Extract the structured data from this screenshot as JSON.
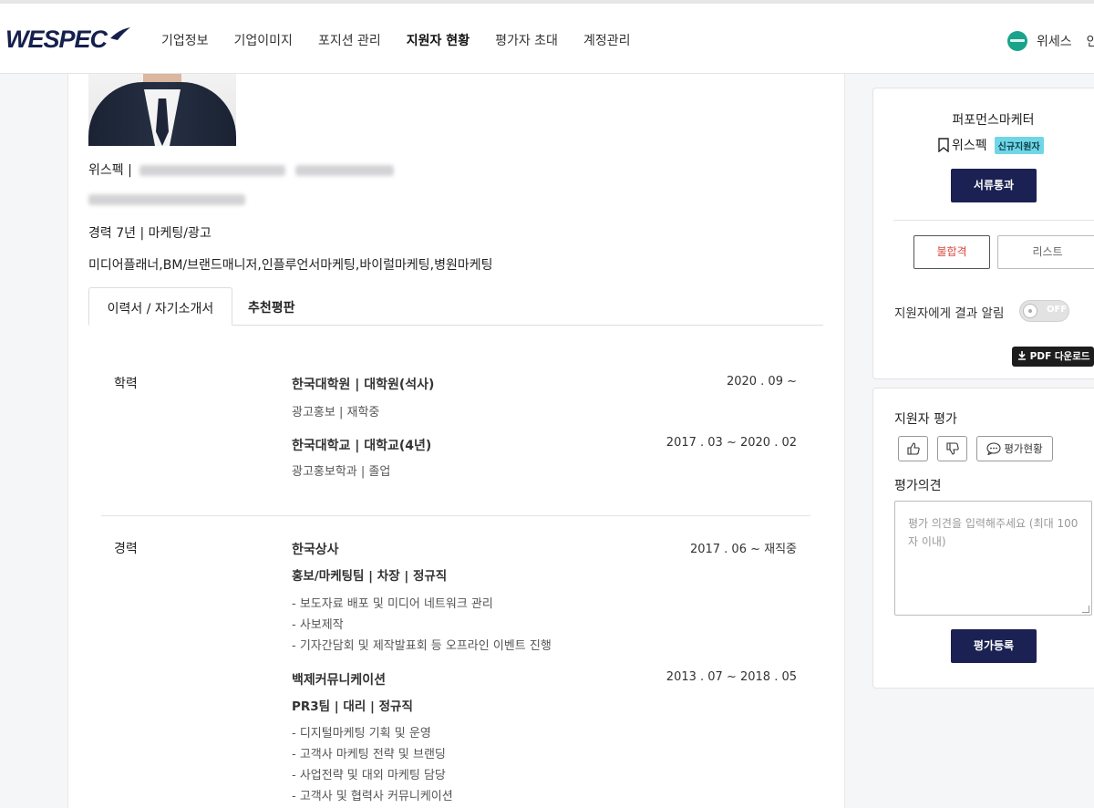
{
  "header": {
    "logo": "WESPEC",
    "nav": [
      "기업정보",
      "기업이미지",
      "포지션 관리",
      "지원자 현황",
      "평가자 초대",
      "계정관리"
    ],
    "active_nav": "지원자 현황",
    "user_name": "위세스",
    "user_extra": "안"
  },
  "profile": {
    "name_prefix": "위스펙 |",
    "career_summary": "경력 7년 | 마케팅/광고",
    "keywords": "미디어플래너,BM/브랜드매니저,인플루언서마케팅,바이럴마케팅,병원마케팅"
  },
  "tabs": [
    "이력서 / 자기소개서",
    "추천평판"
  ],
  "education": {
    "label": "학력",
    "entries": [
      {
        "title": "한국대학원 | 대학원(석사)",
        "sub": "광고홍보 | 재학중",
        "date": "2020 . 09 ~"
      },
      {
        "title": "한국대학교 | 대학교(4년)",
        "sub": "광고홍보학과 | 졸업",
        "date": "2017 . 03 ~ 2020 . 02"
      }
    ]
  },
  "career": {
    "label": "경력",
    "entries": [
      {
        "company": "한국상사",
        "role": "홍보/마케팅팀 | 차장 | 정규직",
        "date": "2017 . 06 ~ 재직중",
        "duties": [
          "- 보도자료 배포 및 미디어 네트워크 관리",
          "- 사보제작",
          "- 기자간담회 및 제작발표회 등 오프라인 이벤트 진행"
        ]
      },
      {
        "company": "백제커뮤니케이션",
        "role": "PR3팀 | 대리 | 정규직",
        "date": "2013 . 07 ~ 2018 . 05",
        "duties": [
          "- 디지털마케팅 기획 및 운영",
          "- 고객사 마케팅 전략 및 브랜딩",
          "- 사업전략 및 대외 마케팅 담당",
          "- 고객사 및 협력사 커뮤니케이션"
        ]
      }
    ]
  },
  "side": {
    "position_title": "퍼포먼스마케터",
    "company": "위스펙",
    "badge": "신규지원자",
    "pass_button": "서류통과",
    "fail_button": "불합격",
    "list_button": "리스트",
    "notify_label": "지원자에게 결과 알림",
    "toggle_state": "OFF",
    "pdf_button": "PDF 다운로드",
    "eval_title": "지원자 평가",
    "eval_status_button": "평가현황",
    "opinion_label": "평가의견",
    "opinion_placeholder": "평가 의견을 입력해주세요 (최대 100자 이내)",
    "submit_button": "평가등록"
  },
  "colors": {
    "navy": "#1b2152",
    "fail_red": "#d9463f",
    "badge_cyan": "#6fd6e6",
    "avatar_green": "#1aa38a"
  }
}
